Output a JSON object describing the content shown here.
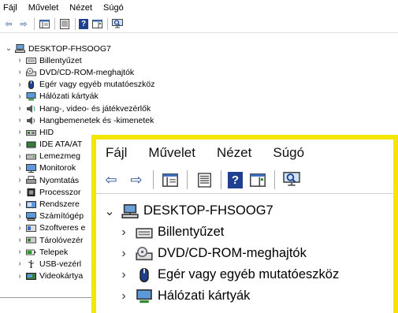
{
  "menu": [
    "Fájl",
    "Művelet",
    "Nézet",
    "Súgó"
  ],
  "toolbar": {
    "back": "⇦",
    "forward": "⇨",
    "help": "?"
  },
  "tree": {
    "root": "DESKTOP-FHSOOG7",
    "items": [
      {
        "label": "Billentyűzet",
        "icon": "keyboard-icon"
      },
      {
        "label": "DVD/CD-ROM-meghajtók",
        "icon": "dvd-drive-icon"
      },
      {
        "label": "Egér vagy egyéb mutatóeszköz",
        "icon": "mouse-icon"
      },
      {
        "label": "Hálózati kártyák",
        "icon": "network-adapter-icon"
      },
      {
        "label": "Hang-, video- és játékvezérlők",
        "icon": "audio-icon"
      },
      {
        "label": "Hangbemenetek és -kimenetek",
        "icon": "speaker-icon"
      },
      {
        "label": "HID",
        "icon": "hid-icon"
      },
      {
        "label": "IDE ATA/AT",
        "icon": "ide-controller-icon"
      },
      {
        "label": "Lemezmeg",
        "icon": "disk-drive-icon"
      },
      {
        "label": "Monitorok",
        "icon": "monitor-icon"
      },
      {
        "label": "Nyomtatás",
        "icon": "printer-icon"
      },
      {
        "label": "Processzor",
        "icon": "processor-icon"
      },
      {
        "label": "Rendszere",
        "icon": "system-devices-icon"
      },
      {
        "label": "Számítógép",
        "icon": "computer-icon"
      },
      {
        "label": "Szoftveres e",
        "icon": "software-device-icon"
      },
      {
        "label": "Tárolóvezér",
        "icon": "storage-controller-icon"
      },
      {
        "label": "Telepek",
        "icon": "battery-icon"
      },
      {
        "label": "USB-vezérl",
        "icon": "usb-icon"
      },
      {
        "label": "Videokártya",
        "icon": "display-adapter-icon"
      }
    ]
  },
  "zoom": {
    "menu": [
      "Fájl",
      "Művelet",
      "Nézet",
      "Súgó"
    ],
    "root": "DESKTOP-FHSOOG7",
    "items": [
      "Billentyűzet",
      "DVD/CD-ROM-meghajtók",
      "Egér vagy egyéb mutatóeszköz",
      "Hálózati kártyák"
    ]
  },
  "colors": {
    "highlight": "#f5e600",
    "accent": "#2a4f9a"
  }
}
